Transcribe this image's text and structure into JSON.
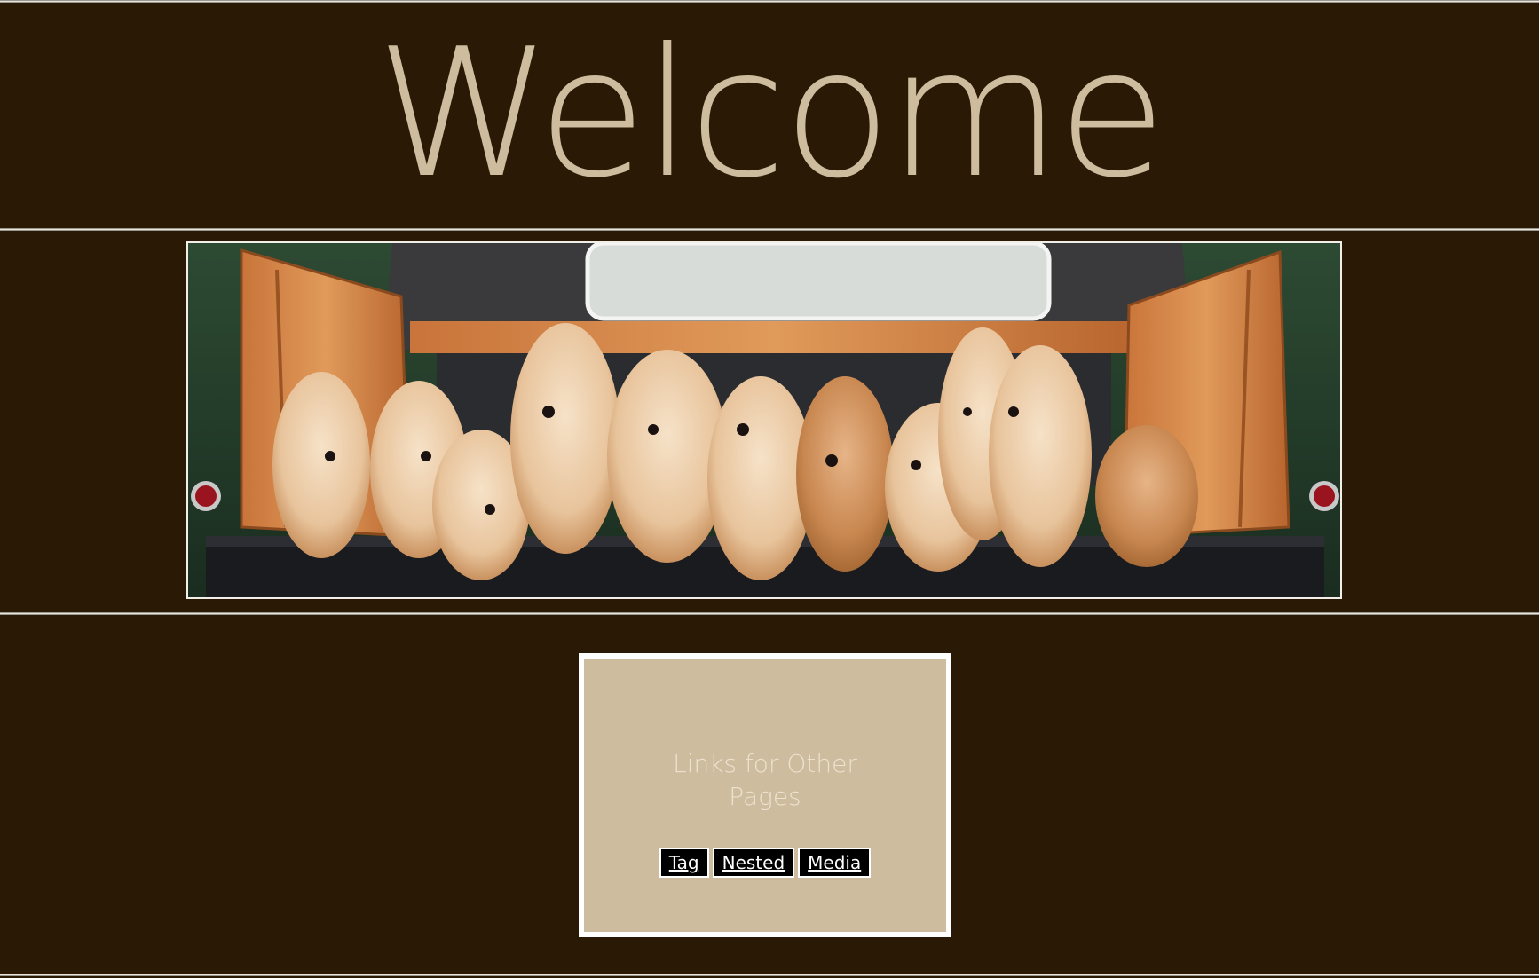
{
  "header": {
    "title": "Welcome"
  },
  "banner": {
    "image_icon": "puppies-on-truck-tailgate-photo"
  },
  "links_section": {
    "title": "Links for Other Pages",
    "links": [
      {
        "label": "Tag "
      },
      {
        "label": "Nested "
      },
      {
        "label": "Media"
      }
    ]
  },
  "colors": {
    "background": "#2a1a05",
    "accent": "#cdbc9e",
    "rule": "#e8e4dc",
    "link_bg": "#000000",
    "link_text": "#ffffff"
  }
}
